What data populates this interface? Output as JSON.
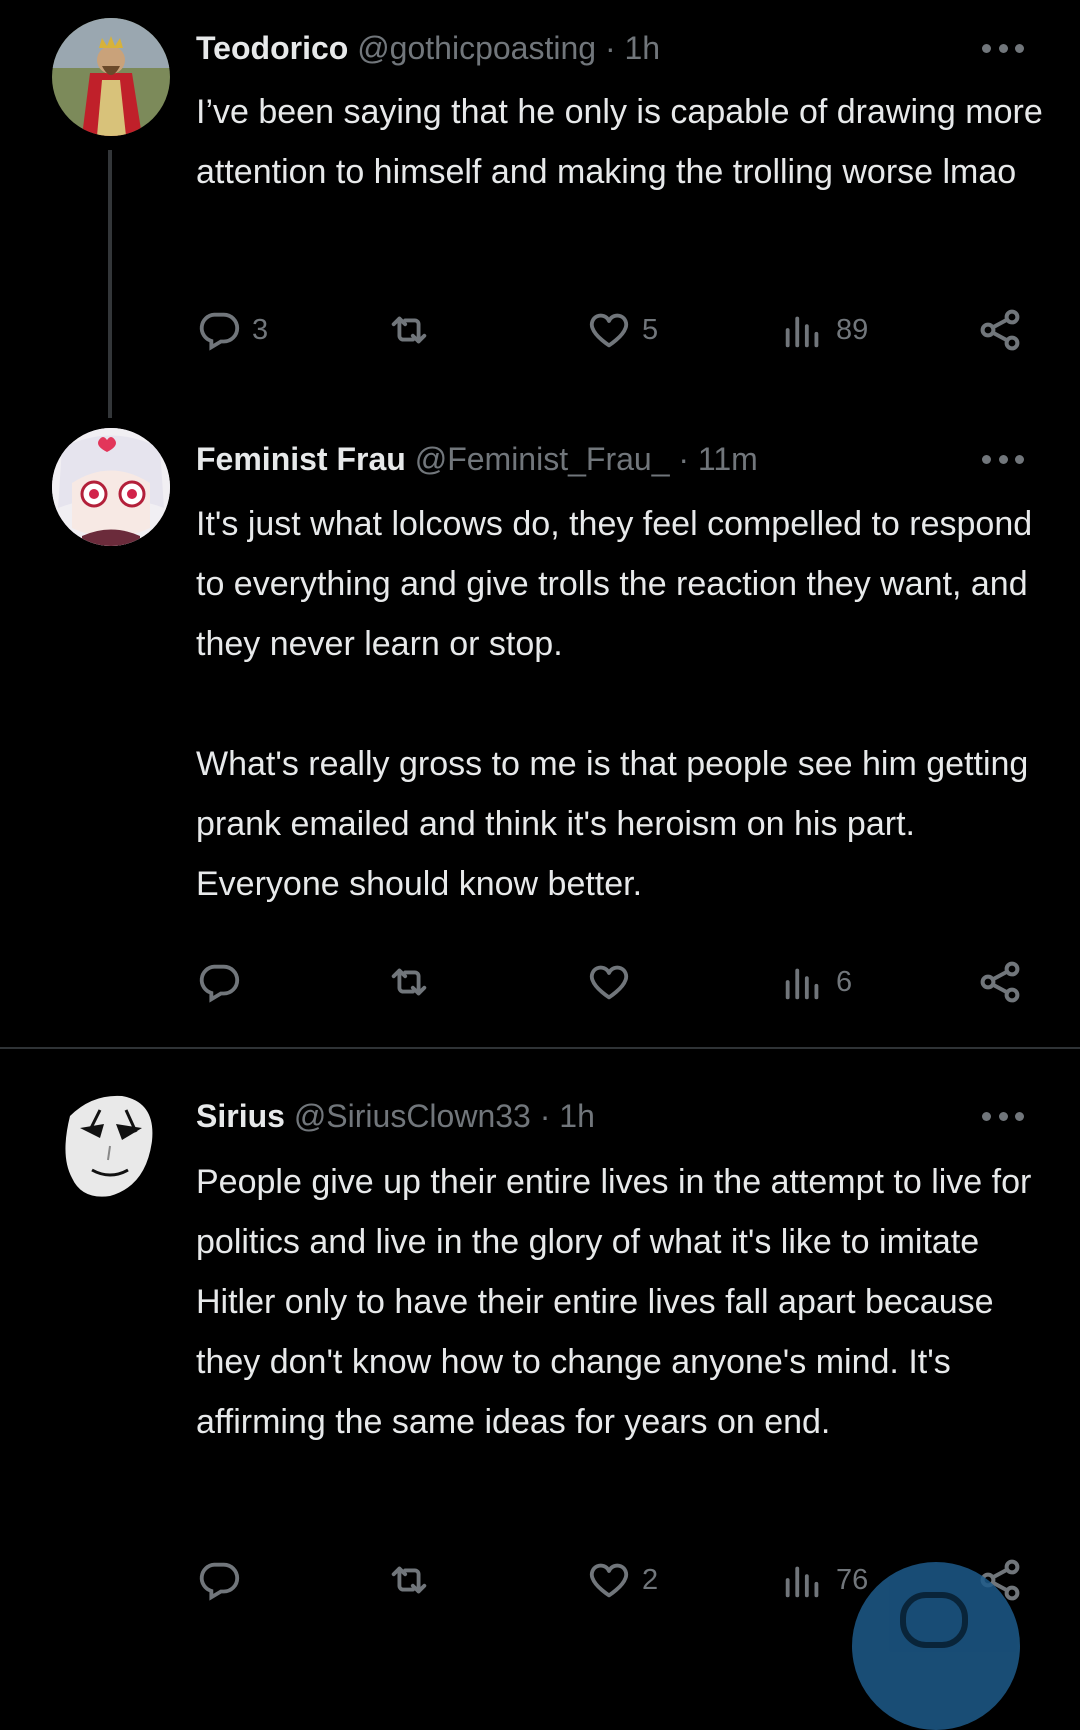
{
  "posts": [
    {
      "name": "Teodorico",
      "handle": "@gothicpoasting",
      "separator": "·",
      "time": "1h",
      "text": "I’ve been saying that he only is capable of drawing more attention to himself and making the trolling worse lmao",
      "replies": "3",
      "retweets": "",
      "likes": "5",
      "views": "89"
    },
    {
      "name": "Feminist Frau",
      "handle": "@Feminist_Frau_",
      "separator": "·",
      "time": "11m",
      "text": "It's just what lolcows do, they feel compelled to respond to everything and give trolls the reaction they want, and they never learn or stop.\n\nWhat's really gross to me is that people see him getting prank emailed and think it's heroism on his part. Everyone should know better.",
      "replies": "",
      "retweets": "",
      "likes": "",
      "views": "6"
    },
    {
      "name": "Sirius",
      "handle": "@SiriusClown33",
      "separator": "·",
      "time": "1h",
      "text": "People give up their entire lives in the attempt to live for politics and live in the glory of what it's like to imitate Hitler only to have their entire lives fall apart because they don't know how to change anyone's mind. It's affirming the same ideas for years on end.",
      "replies": "",
      "retweets": "",
      "likes": "2",
      "views": "76"
    }
  ],
  "icons": {
    "reply": "reply-icon",
    "retweet": "retweet-icon",
    "like": "heart-icon",
    "views": "views-icon",
    "share": "share-icon",
    "more": "more-icon",
    "compose": "compose-icon"
  },
  "colors": {
    "background": "#000000",
    "text": "#e7e9ea",
    "muted": "#71767b",
    "divider": "#2f3336",
    "fab": "#1d5a8a"
  }
}
